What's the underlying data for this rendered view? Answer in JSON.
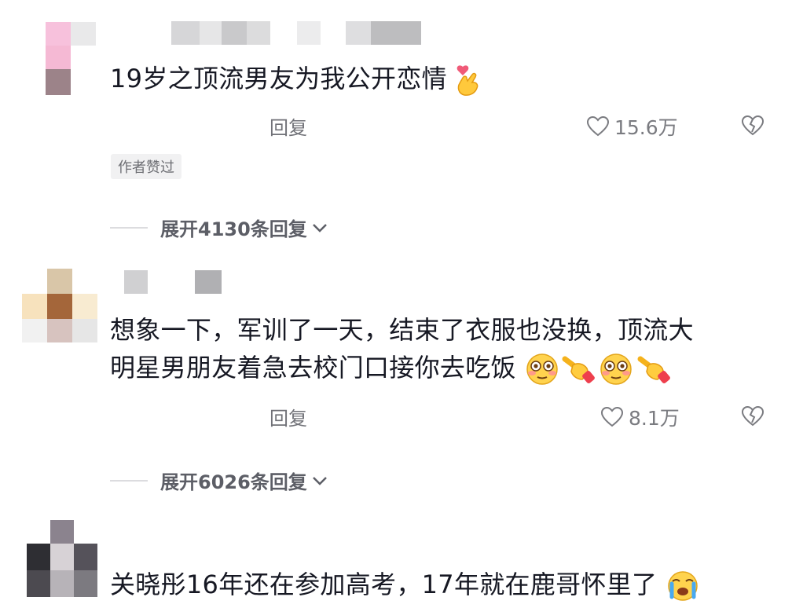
{
  "comments": [
    {
      "text": "19岁之顶流男友为我公开恋情",
      "reply_label": "回复",
      "likes": "15.6万",
      "author_badge": "作者赞过",
      "expand_label": "展开4130条回复"
    },
    {
      "text_line1": "想象一下，军训了一天，结束了衣服也没换，顶流大",
      "text_line2": "明星男朋友着急去校门口接你去吃饭",
      "reply_label": "回复",
      "likes": "8.1万",
      "expand_label": "展开6026条回复"
    },
    {
      "text": "关晓彤16年还在参加高考，17年就在鹿哥怀里了"
    }
  ],
  "icons": {
    "like": "heart-outline-icon",
    "dislike": "broken-heart-icon",
    "expand_chevron": "chevron-down-icon",
    "emoji_finger_heart": "finger-heart-emoji",
    "emoji_flushed": "flushed-face-emoji",
    "emoji_pointing": "pointing-hand-emoji",
    "emoji_crying": "crying-face-emoji"
  },
  "colors": {
    "text": "#161823",
    "meta": "#707177",
    "badge_bg": "#f1f1f2"
  }
}
